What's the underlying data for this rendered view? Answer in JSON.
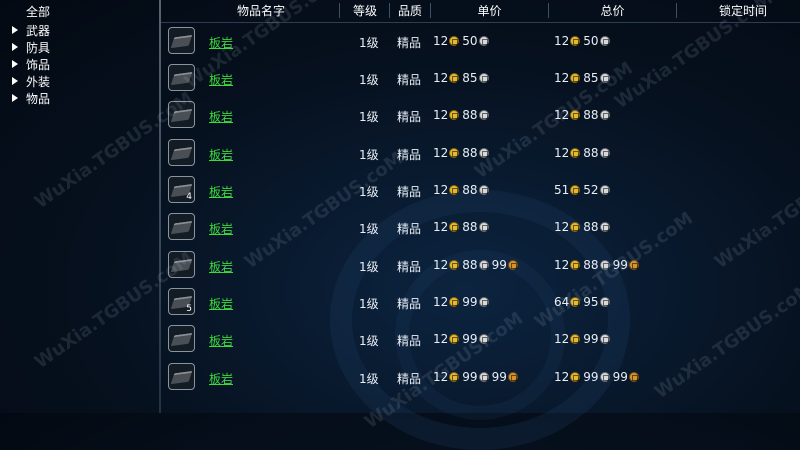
{
  "sidebar": {
    "title": "全部",
    "items": [
      {
        "label": "武器"
      },
      {
        "label": "防具"
      },
      {
        "label": "饰品"
      },
      {
        "label": "外装"
      },
      {
        "label": "物品"
      }
    ]
  },
  "table": {
    "columns": [
      "物品名字",
      "等级",
      "品质",
      "单价",
      "总价",
      "锁定时间"
    ],
    "rows": [
      {
        "name": "板岩",
        "qty": "",
        "level": "1级",
        "quality": "精品",
        "unit": [
          [
            "12",
            "gold"
          ],
          [
            "50",
            "silver"
          ]
        ],
        "total": [
          [
            "12",
            "gold"
          ],
          [
            "50",
            "silver"
          ]
        ]
      },
      {
        "name": "板岩",
        "qty": "",
        "level": "1级",
        "quality": "精品",
        "unit": [
          [
            "12",
            "gold"
          ],
          [
            "85",
            "silver"
          ]
        ],
        "total": [
          [
            "12",
            "gold"
          ],
          [
            "85",
            "silver"
          ]
        ]
      },
      {
        "name": "板岩",
        "qty": "",
        "level": "1级",
        "quality": "精品",
        "unit": [
          [
            "12",
            "gold"
          ],
          [
            "88",
            "silver"
          ]
        ],
        "total": [
          [
            "12",
            "gold"
          ],
          [
            "88",
            "silver"
          ]
        ]
      },
      {
        "name": "板岩",
        "qty": "",
        "level": "1级",
        "quality": "精品",
        "unit": [
          [
            "12",
            "gold"
          ],
          [
            "88",
            "silver"
          ]
        ],
        "total": [
          [
            "12",
            "gold"
          ],
          [
            "88",
            "silver"
          ]
        ]
      },
      {
        "name": "板岩",
        "qty": "4",
        "level": "1级",
        "quality": "精品",
        "unit": [
          [
            "12",
            "gold"
          ],
          [
            "88",
            "silver"
          ]
        ],
        "total": [
          [
            "51",
            "gold"
          ],
          [
            "52",
            "silver"
          ]
        ]
      },
      {
        "name": "板岩",
        "qty": "",
        "level": "1级",
        "quality": "精品",
        "unit": [
          [
            "12",
            "gold"
          ],
          [
            "88",
            "silver"
          ]
        ],
        "total": [
          [
            "12",
            "gold"
          ],
          [
            "88",
            "silver"
          ]
        ]
      },
      {
        "name": "板岩",
        "qty": "",
        "level": "1级",
        "quality": "精品",
        "unit": [
          [
            "12",
            "gold"
          ],
          [
            "88",
            "silver"
          ],
          [
            "99",
            "copper"
          ]
        ],
        "total": [
          [
            "12",
            "gold"
          ],
          [
            "88",
            "silver"
          ],
          [
            "99",
            "copper"
          ]
        ]
      },
      {
        "name": "板岩",
        "qty": "5",
        "level": "1级",
        "quality": "精品",
        "unit": [
          [
            "12",
            "gold"
          ],
          [
            "99",
            "silver"
          ]
        ],
        "total": [
          [
            "64",
            "gold"
          ],
          [
            "95",
            "silver"
          ]
        ]
      },
      {
        "name": "板岩",
        "qty": "",
        "level": "1级",
        "quality": "精品",
        "unit": [
          [
            "12",
            "gold"
          ],
          [
            "99",
            "silver"
          ]
        ],
        "total": [
          [
            "12",
            "gold"
          ],
          [
            "99",
            "silver"
          ]
        ]
      },
      {
        "name": "板岩",
        "qty": "",
        "level": "1级",
        "quality": "精品",
        "unit": [
          [
            "12",
            "gold"
          ],
          [
            "99",
            "silver"
          ],
          [
            "99",
            "copper"
          ]
        ],
        "total": [
          [
            "12",
            "gold"
          ],
          [
            "99",
            "silver"
          ],
          [
            "99",
            "copper"
          ]
        ]
      }
    ]
  },
  "watermark": "WuXia.TGBUS.coM",
  "colors": {
    "item_name": "#3cd83c",
    "gold_coin": "#e3b92f",
    "silver_coin": "#d6d8da",
    "copper_coin": "#d4932e"
  }
}
